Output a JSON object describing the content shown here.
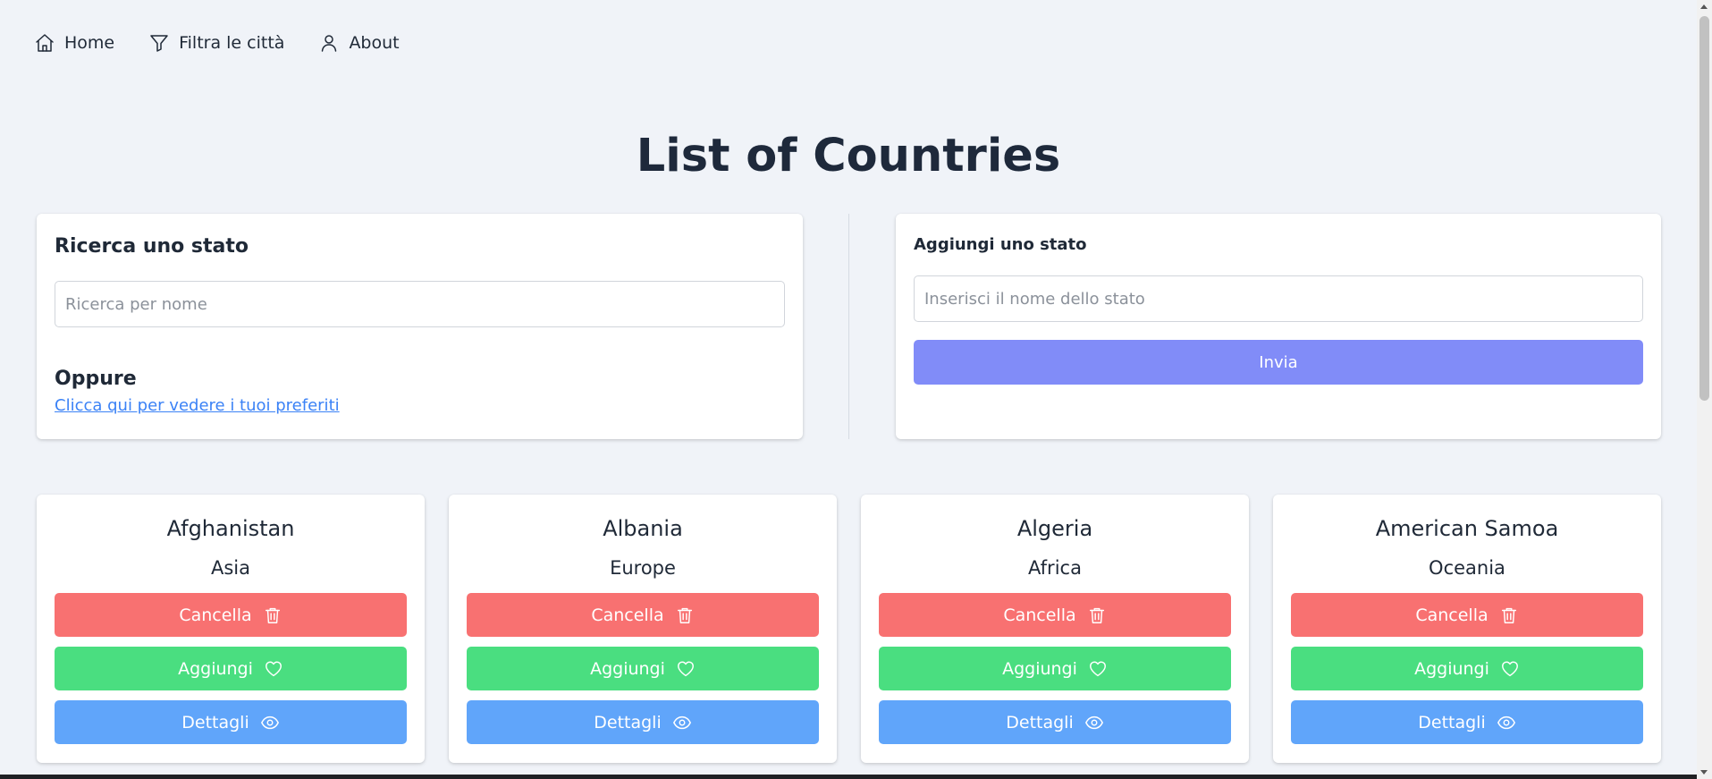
{
  "nav": {
    "home": "Home",
    "filter": "Filtra le città",
    "about": "About"
  },
  "page_title": "List of Countries",
  "search_panel": {
    "heading": "Ricerca uno stato",
    "placeholder": "Ricerca per nome",
    "value": "",
    "oppure": "Oppure",
    "favorites_link": "Clicca qui per vedere i tuoi preferiti"
  },
  "add_panel": {
    "heading": "Aggiungi uno stato",
    "placeholder": "Inserisci il nome dello stato",
    "value": "",
    "submit": "Invia"
  },
  "countries": [
    {
      "name": "Afghanistan",
      "continent": "Asia",
      "delete": "Cancella",
      "add": "Aggiungi",
      "details": "Dettagli"
    },
    {
      "name": "Albania",
      "continent": "Europe",
      "delete": "Cancella",
      "add": "Aggiungi",
      "details": "Dettagli"
    },
    {
      "name": "Algeria",
      "continent": "Africa",
      "delete": "Cancella",
      "add": "Aggiungi",
      "details": "Dettagli"
    },
    {
      "name": "American Samoa",
      "continent": "Oceania",
      "delete": "Cancella",
      "add": "Aggiungi",
      "details": "Dettagli"
    }
  ],
  "icons": {
    "home": "home-icon",
    "filter": "filter-icon",
    "about": "user-icon",
    "delete": "trash-icon",
    "add": "heart-icon",
    "details": "eye-icon"
  },
  "colors": {
    "background": "#f0f3f8",
    "delete_button": "#f87171",
    "add_button": "#4ade80",
    "details_button": "#60a5fa",
    "submit_button": "#818cf8",
    "link": "#3b82f6"
  }
}
